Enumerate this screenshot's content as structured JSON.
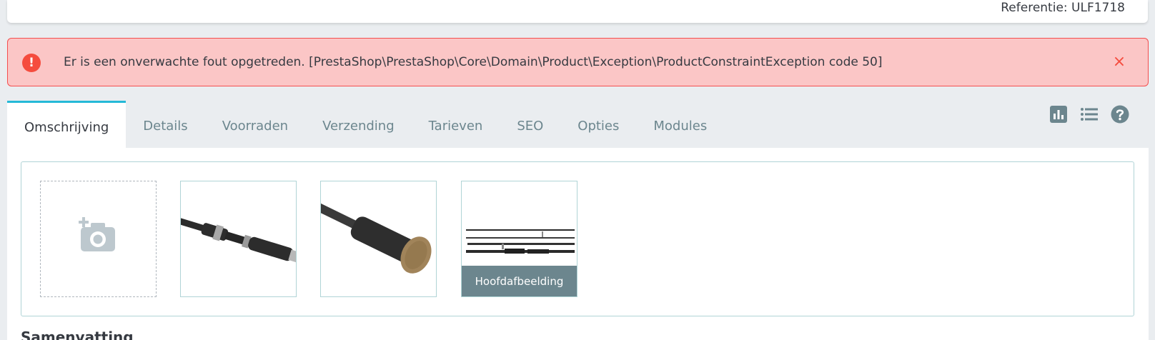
{
  "header": {
    "reference": "Referentie: ULF1718"
  },
  "alert": {
    "icon": "exclamation-icon",
    "message": "Er is een onverwachte fout opgetreden. [PrestaShop\\PrestaShop\\Core\\Domain\\Product\\Exception\\ProductConstraintException code 50]",
    "close_symbol": "×",
    "color": "#f54c3e"
  },
  "tabs": [
    {
      "label": "Omschrijving",
      "active": true
    },
    {
      "label": "Details"
    },
    {
      "label": "Voorraden"
    },
    {
      "label": "Verzending"
    },
    {
      "label": "Tarieven"
    },
    {
      "label": "SEO"
    },
    {
      "label": "Opties"
    },
    {
      "label": "Modules"
    }
  ],
  "toolbar": {
    "icons": [
      "stats-icon",
      "list-icon",
      "help-icon"
    ]
  },
  "images": {
    "add_icon": "add-photo-icon",
    "items": [
      {
        "name": "rod-handle-reel-seat"
      },
      {
        "name": "rod-cork-butt"
      },
      {
        "name": "rod-sections",
        "cover": true
      }
    ],
    "cover_label": "Hoofdafbeelding"
  },
  "summary": {
    "title": "Samenvatting"
  },
  "colors": {
    "accent": "#25b9d7",
    "danger": "#f54c3e",
    "muted": "#6c868e"
  }
}
